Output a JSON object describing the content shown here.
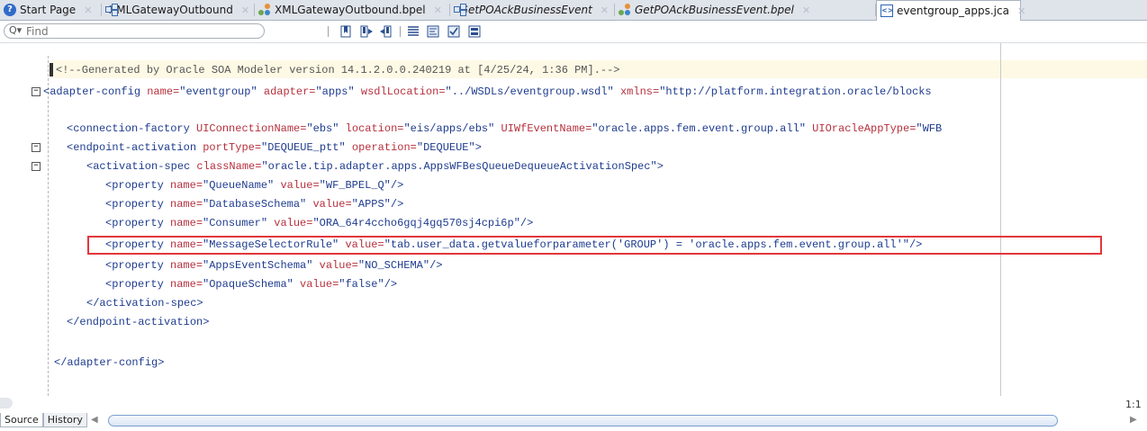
{
  "tabs": [
    {
      "label": "Start Page",
      "icon": "help-icon",
      "italic": false,
      "active": false
    },
    {
      "label": "XMLGatewayOutbound",
      "icon": "composite-icon",
      "italic": false,
      "active": false
    },
    {
      "label": "XMLGatewayOutbound.bpel",
      "icon": "bpel-icon",
      "italic": false,
      "active": false
    },
    {
      "label": "GetPOAckBusinessEvent",
      "icon": "composite-icon",
      "italic": true,
      "active": false
    },
    {
      "label": "GetPOAckBusinessEvent.bpel",
      "icon": "bpel-icon",
      "italic": true,
      "active": false
    },
    {
      "label": "eventgroup_apps.jca",
      "icon": "jca-file-icon",
      "italic": false,
      "active": true
    }
  ],
  "toolbar": {
    "search_placeholder": "Find",
    "buttons": [
      "bookmark-icon",
      "next-bookmark-icon",
      "prev-bookmark-icon",
      "indent-icon",
      "format-icon",
      "validate-icon",
      "settings-icon"
    ]
  },
  "code": {
    "line1": "<!--Generated by Oracle SOA Modeler version 14.1.2.0.0.240219 at [4/25/24, 1:36 PM].-->",
    "line2": {
      "tag": "<adapter-config",
      "a1": " name=",
      "v1": "\"eventgroup\"",
      "a2": " adapter=",
      "v2": "\"apps\"",
      "a3": " wsdlLocation=",
      "v3": "\"../WSDLs/eventgroup.wsdl\"",
      "a4": " xmlns=",
      "v4": "\"http://platform.integration.oracle/blocks"
    },
    "line4": {
      "tag": "<connection-factory",
      "a1": " UIConnectionName=",
      "v1": "\"ebs\"",
      "a2": " location=",
      "v2": "\"eis/apps/ebs\"",
      "a3": " UIWfEventName=",
      "v3": "\"oracle.apps.fem.event.group.all\"",
      "a4": " UIOracleAppType=",
      "v4": "\"WFB"
    },
    "line5": {
      "tag": "<endpoint-activation",
      "a1": " portType=",
      "v1": "\"DEQUEUE_ptt\"",
      "a2": " operation=",
      "v2": "\"DEQUEUE\"",
      "end": ">"
    },
    "line6": {
      "tag": "<activation-spec",
      "a1": " className=",
      "v1": "\"oracle.tip.adapter.apps.AppsWFBesQueueDequeueActivationSpec\"",
      "end": ">"
    },
    "properties": [
      {
        "name": "\"QueueName\"",
        "value": "\"WF_BPEL_Q\""
      },
      {
        "name": "\"DatabaseSchema\"",
        "value": "\"APPS\""
      },
      {
        "name": "\"Consumer\"",
        "value": "\"ORA_64r4ccho6gqj4gq570sj4cpi6p\""
      },
      {
        "name": "\"MessageSelectorRule\"",
        "value": "\"tab.user_data.getvalueforparameter('GROUP') = 'oracle.apps.fem.event.group.all'\""
      },
      {
        "name": "\"AppsEventSchema\"",
        "value": "\"NO_SCHEMA\""
      },
      {
        "name": "\"OpaqueSchema\"",
        "value": "\"false\""
      }
    ],
    "prop_tag": "<property",
    "prop_name_attr": " name=",
    "prop_value_attr": " value=",
    "prop_end": "/>",
    "close_activation": "</activation-spec>",
    "close_endpoint": "</endpoint-activation>",
    "close_adapter": "</adapter-config>"
  },
  "status": {
    "position": "1:1"
  },
  "bottom_tabs": [
    "Source",
    "History"
  ]
}
